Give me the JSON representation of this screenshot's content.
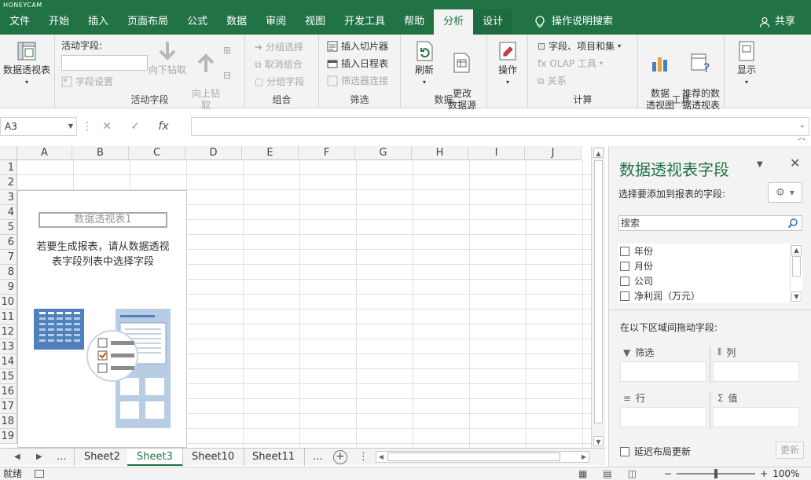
{
  "app": {
    "watermark": "HONEYCAM",
    "tabs": [
      {
        "label": "文件"
      },
      {
        "label": "开始"
      },
      {
        "label": "插入"
      },
      {
        "label": "页面布局"
      },
      {
        "label": "公式"
      },
      {
        "label": "数据"
      },
      {
        "label": "审阅"
      },
      {
        "label": "视图"
      },
      {
        "label": "开发工具"
      },
      {
        "label": "帮助"
      },
      {
        "label": "分析"
      },
      {
        "label": "设计"
      }
    ],
    "active_tab": "分析",
    "tell_me": "操作说明搜索",
    "share": "共享",
    "accent_color": "#217346"
  },
  "ribbon": {
    "pivot_table_btn": "数据透视表",
    "active_field_title": "活动字段:",
    "field_settings": "字段设置",
    "drill_down": "向下钻取",
    "drill_up": "向上钻\n取",
    "group_active_field": "活动字段",
    "group_selection": "分组选择",
    "ungroup": "取消组合",
    "group_field": "分组字段",
    "group_group": "组合",
    "insert_slicer": "插入切片器",
    "insert_timeline": "插入日程表",
    "filter_connections": "筛选器连接",
    "group_filter": "筛选",
    "refresh": "刷新",
    "change_source": "更改\n数据源",
    "group_data": "数据",
    "actions": "操作",
    "fields_items_sets": "字段、项目和集",
    "olap_tools": "OLAP 工具",
    "relationships": "关系",
    "group_calc": "计算",
    "pivot_chart": "数据\n透视图",
    "recommended_pivot": "推荐的数\n据透视表",
    "group_tools": "工具",
    "show": "显示"
  },
  "formula_bar": {
    "name_box": "A3",
    "fx": "fx",
    "value": ""
  },
  "grid": {
    "columns": [
      "A",
      "B",
      "C",
      "D",
      "E",
      "F",
      "G",
      "H",
      "I",
      "J"
    ],
    "rows": [
      "1",
      "2",
      "3",
      "4",
      "5",
      "6",
      "7",
      "8",
      "9",
      "10",
      "11",
      "12",
      "13",
      "14",
      "15",
      "16",
      "17",
      "18",
      "19"
    ],
    "pivot_name": "数据透视表1",
    "pivot_hint_line1": "若要生成报表，请从数据透视",
    "pivot_hint_line2": "表字段列表中选择字段"
  },
  "sheets": {
    "more_left": "...",
    "tabs": [
      {
        "label": "Sheet2"
      },
      {
        "label": "Sheet3"
      },
      {
        "label": "Sheet10"
      },
      {
        "label": "Sheet11"
      }
    ],
    "active": "Sheet3",
    "more_right": "..."
  },
  "status": {
    "ready": "就绪",
    "zoom": "100%"
  },
  "field_pane": {
    "title": "数据透视表字段",
    "choose_label": "选择要添加到报表的字段:",
    "search_placeholder": "搜索",
    "fields": [
      {
        "name": "年份",
        "checked": false
      },
      {
        "name": "月份",
        "checked": false
      },
      {
        "name": "公司",
        "checked": false
      },
      {
        "name": "净利润（万元）",
        "checked": false
      }
    ],
    "drag_label": "在以下区域间拖动字段:",
    "areas": {
      "filters": "筛选",
      "columns": "列",
      "rows": "行",
      "values": "值"
    },
    "defer_label": "延迟布局更新",
    "update_btn": "更新"
  }
}
